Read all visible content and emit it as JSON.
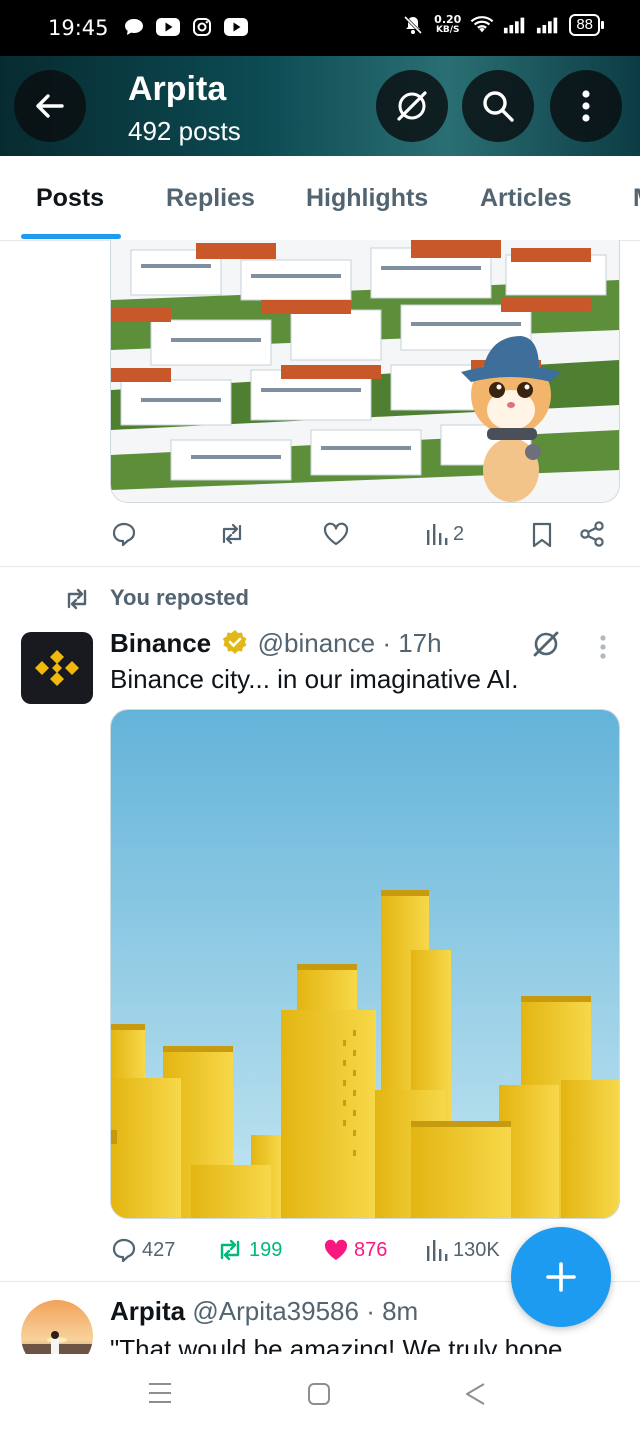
{
  "status_bar": {
    "time": "19:45",
    "net_speed_value": "0.20",
    "net_speed_unit": "KB/S",
    "battery": "88"
  },
  "header": {
    "title": "Arpita",
    "subtitle": "492 posts"
  },
  "tabs": [
    {
      "label": "Posts",
      "active": true
    },
    {
      "label": "Replies"
    },
    {
      "label": "Highlights"
    },
    {
      "label": "Articles"
    },
    {
      "label": "M"
    }
  ],
  "post1": {
    "views": "2"
  },
  "repost": {
    "label": "You reposted"
  },
  "post2": {
    "author": "Binance",
    "handle": "@binance",
    "time": "· 17h",
    "text": "Binance city... in our imaginative AI.",
    "replies": "427",
    "reposts": "199",
    "likes": "876",
    "views": "130K"
  },
  "post3": {
    "author": "Arpita",
    "handle": "@Arpita39586",
    "time": "· 8m",
    "text": "\"That would be amazing! We truly hope"
  },
  "colors": {
    "accent": "#1d9bf0",
    "like": "#f91880",
    "repost": "#00ba7c",
    "verified": "#e2b719",
    "binance": "#f0b90b"
  }
}
